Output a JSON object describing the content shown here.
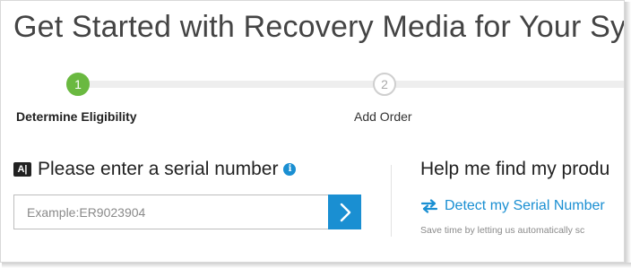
{
  "header": {
    "title": "Get Started with Recovery Media for Your Sy"
  },
  "stepper": {
    "steps": [
      {
        "number": "1",
        "label": "Determine Eligibility",
        "state": "active"
      },
      {
        "number": "2",
        "label": "Add Order",
        "state": "inactive"
      }
    ]
  },
  "serial": {
    "title": "Please enter a serial number",
    "keyboard_icon": "keyboard-icon",
    "info_icon": "info-icon",
    "input_value": "",
    "input_placeholder": "Example:ER9023904",
    "submit_icon": "chevron-right-icon"
  },
  "help": {
    "title": "Help me find my produ",
    "detect_link": "Detect my Serial Number",
    "detect_icon": "swap-arrows-icon",
    "note": "Save time by letting us automatically sc"
  },
  "colors": {
    "accent_blue": "#1a8fd2",
    "step_active_green": "#6ab940",
    "text_dark": "#222222",
    "muted": "#8a8a8a"
  }
}
